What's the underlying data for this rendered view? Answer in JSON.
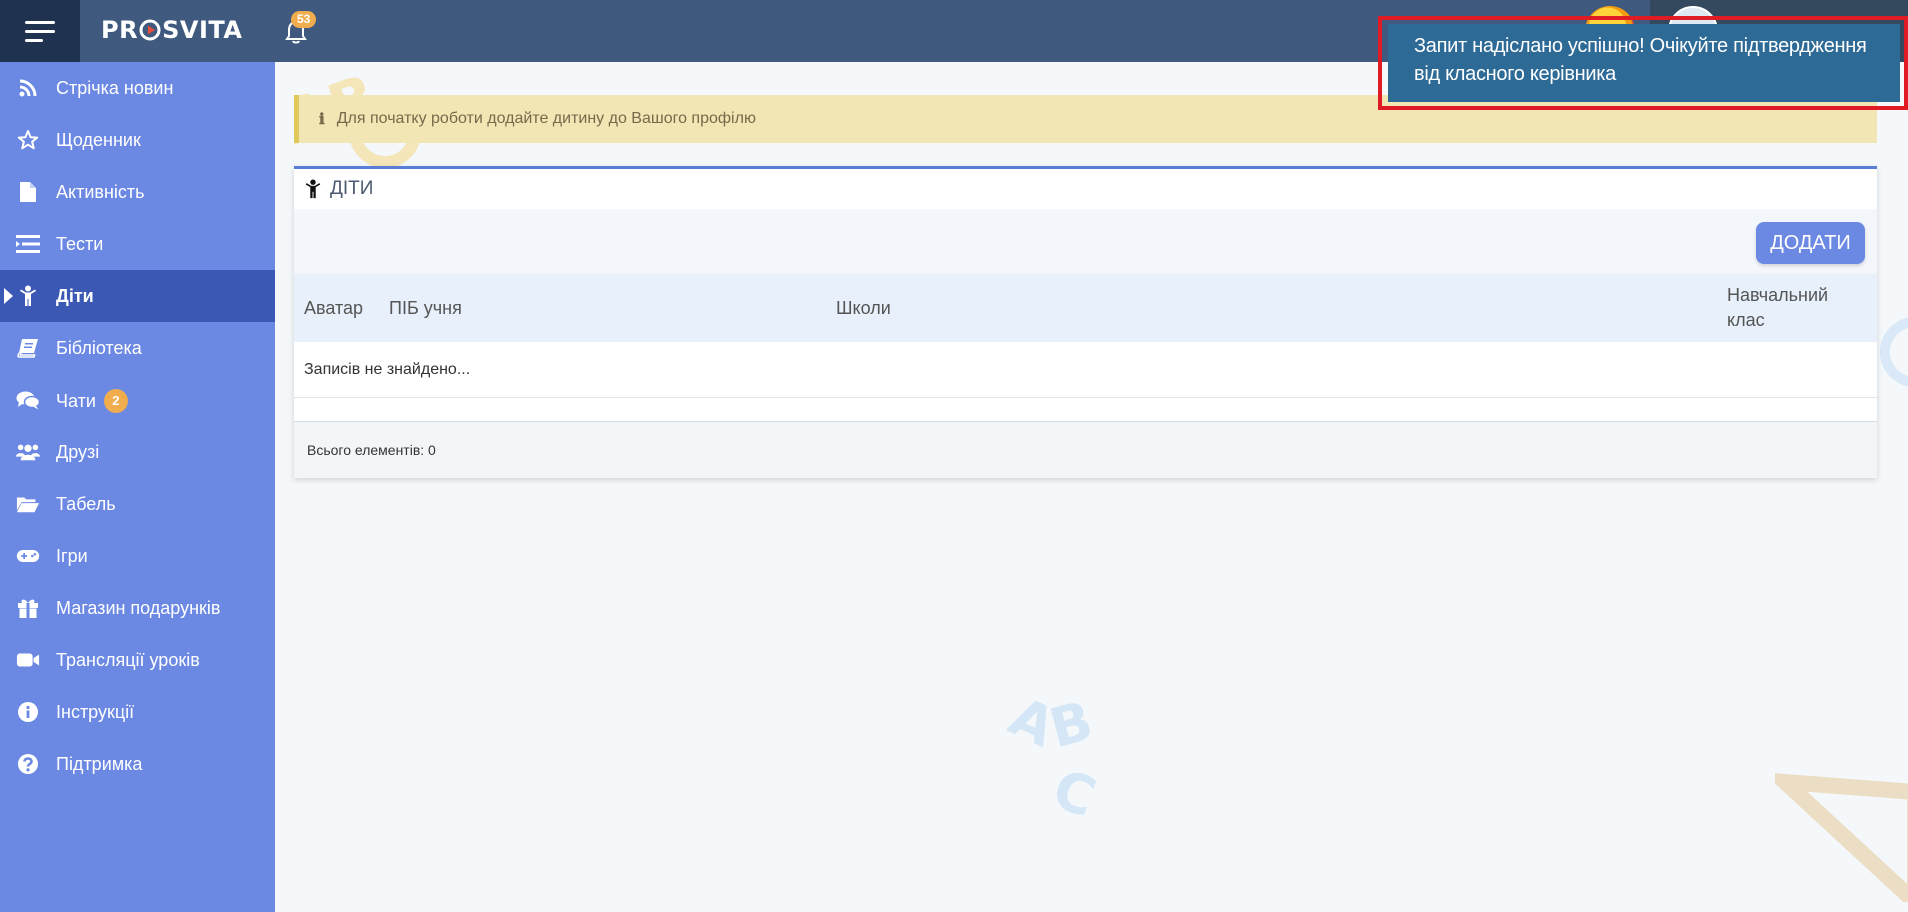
{
  "header": {
    "logo": {
      "before": "PR",
      "after": "SVITA"
    },
    "notifications_count": "53",
    "user_name_partial": ""
  },
  "sidebar": {
    "items": [
      {
        "label": "Стрічка новин",
        "icon": "rss-icon"
      },
      {
        "label": "Щоденник",
        "icon": "star-icon"
      },
      {
        "label": "Активність",
        "icon": "file-icon"
      },
      {
        "label": "Тести",
        "icon": "list-icon"
      },
      {
        "label": "Діти",
        "icon": "child-icon",
        "active": true
      },
      {
        "label": "Бібліотека",
        "icon": "book-icon"
      },
      {
        "label": "Чати",
        "icon": "chat-icon",
        "badge": "2"
      },
      {
        "label": "Друзі",
        "icon": "users-icon"
      },
      {
        "label": "Табель",
        "icon": "folder-open-icon"
      },
      {
        "label": "Ігри",
        "icon": "gamepad-icon"
      },
      {
        "label": "Магазин подарунків",
        "icon": "gift-icon"
      },
      {
        "label": "Трансляції уроків",
        "icon": "video-camera-icon"
      },
      {
        "label": "Інструкції",
        "icon": "info-circle-icon"
      },
      {
        "label": "Підтримка",
        "icon": "question-circle-icon"
      }
    ]
  },
  "alert": {
    "text": "Для початку роботи додайте дитину до Вашого профілю"
  },
  "panel": {
    "title": "ДІТИ",
    "add_button": "ДОДАТИ",
    "columns": [
      "Аватар",
      "ПІБ учня",
      "Школи",
      "Навчальний клас"
    ],
    "empty_text": "Записів не знайдено...",
    "total_text": "Всього елементів: 0"
  },
  "toast": {
    "message": "Запит надіслано успішно! Очікуйте підтвердження від класного керівника"
  },
  "colors": {
    "topbar": "#3f5a7e",
    "sidebar": "#6b88e3",
    "sidebar_active": "#3b58b5",
    "toast": "#2e6a96",
    "badge": "#f0ad4e",
    "highlight_outline": "#e01b24"
  }
}
